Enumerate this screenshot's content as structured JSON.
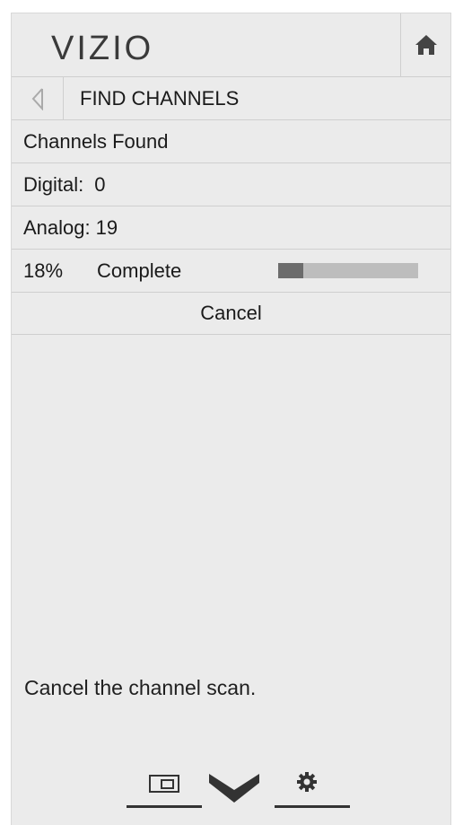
{
  "header": {
    "logo": "VIZIO"
  },
  "nav": {
    "title": "FIND CHANNELS"
  },
  "rows": {
    "channels_found": "Channels Found",
    "digital_label": "Digital:",
    "digital_value": "0",
    "analog_label": "Analog:",
    "analog_value": "19"
  },
  "progress": {
    "percent_label": "18%",
    "label": "Complete",
    "value": 0.18
  },
  "actions": {
    "cancel": "Cancel"
  },
  "help": {
    "text": "Cancel the channel scan."
  },
  "icons": {
    "home": "home-icon",
    "back": "back-arrow-icon",
    "picture": "picture-in-picture-icon",
    "down": "chevron-down-icon",
    "settings": "gear-icon"
  },
  "colors": {
    "panel": "#ebebeb",
    "progress_fill": "#6c6c6c",
    "progress_track": "#bdbdbd"
  }
}
